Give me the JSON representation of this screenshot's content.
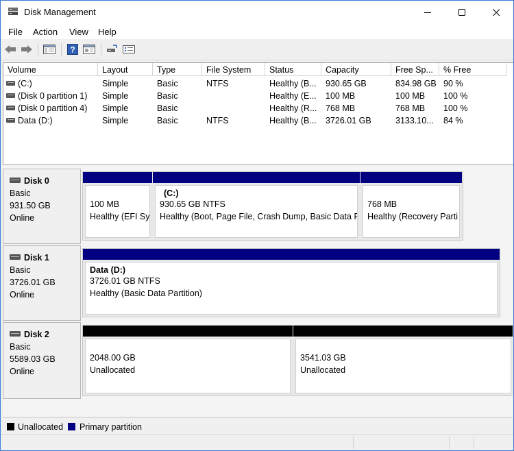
{
  "window": {
    "title": "Disk Management"
  },
  "menu": {
    "items": [
      "File",
      "Action",
      "View",
      "Help"
    ]
  },
  "volume_list": {
    "columns": [
      "Volume",
      "Layout",
      "Type",
      "File System",
      "Status",
      "Capacity",
      "Free Sp...",
      "% Free"
    ],
    "rows": [
      [
        "(C:)",
        "Simple",
        "Basic",
        "NTFS",
        "Healthy (B...",
        "930.65 GB",
        "834.98 GB",
        "90 %"
      ],
      [
        "(Disk 0 partition 1)",
        "Simple",
        "Basic",
        "",
        "Healthy (E...",
        "100 MB",
        "100 MB",
        "100 %"
      ],
      [
        "(Disk 0 partition 4)",
        "Simple",
        "Basic",
        "",
        "Healthy (R...",
        "768 MB",
        "768 MB",
        "100 %"
      ],
      [
        "Data (D:)",
        "Simple",
        "Basic",
        "NTFS",
        "Healthy (B...",
        "3726.01 GB",
        "3133.10...",
        "84 %"
      ]
    ]
  },
  "disks": [
    {
      "name": "Disk 0",
      "type": "Basic",
      "size": "931.50 GB",
      "status": "Online",
      "partitions": [
        {
          "title": "",
          "size": "100 MB",
          "status": "Healthy (EFI Sy",
          "kind": "primary"
        },
        {
          "title": "(C:)",
          "size": "930.65 GB NTFS",
          "status": "Healthy (Boot, Page File, Crash Dump, Basic Data P",
          "kind": "primary"
        },
        {
          "title": "",
          "size": "768 MB",
          "status": "Healthy (Recovery Parti",
          "kind": "primary"
        }
      ]
    },
    {
      "name": "Disk 1",
      "type": "Basic",
      "size": "3726.01 GB",
      "status": "Online",
      "partitions": [
        {
          "title": "Data  (D:)",
          "size": "3726.01 GB NTFS",
          "status": "Healthy (Basic Data Partition)",
          "kind": "primary"
        }
      ]
    },
    {
      "name": "Disk 2",
      "type": "Basic",
      "size": "5589.03 GB",
      "status": "Online",
      "partitions": [
        {
          "title": "",
          "size": "2048.00 GB",
          "status": "Unallocated",
          "kind": "unallocated"
        },
        {
          "title": "",
          "size": "3541.03 GB",
          "status": "Unallocated",
          "kind": "unallocated"
        }
      ]
    }
  ],
  "legend": {
    "unallocated": "Unallocated",
    "primary": "Primary partition"
  },
  "colors": {
    "primary": "#000080",
    "unallocated": "#000000",
    "accent": "#3a7bd5"
  },
  "icons": [
    "back-arrow-icon",
    "forward-arrow-icon",
    "properties-icon",
    "help-icon",
    "console-tree-icon",
    "connect-disk-icon",
    "rescan-icon"
  ]
}
